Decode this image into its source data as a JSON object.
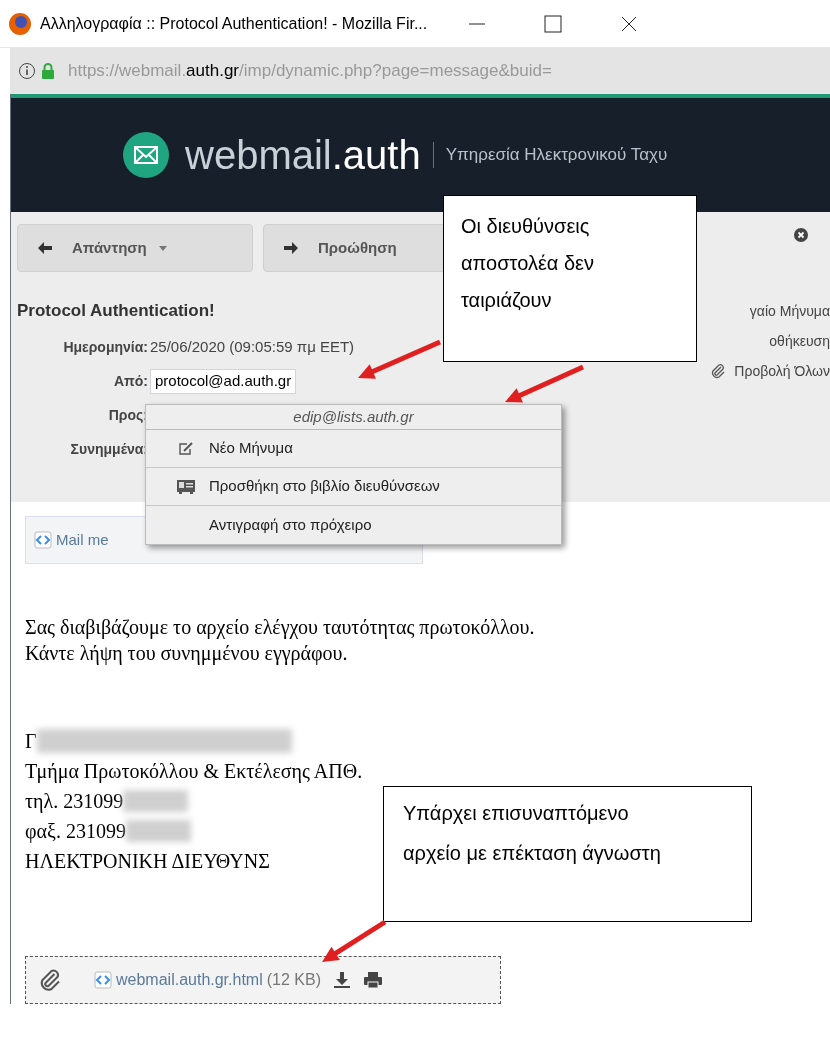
{
  "window": {
    "title": "Αλληλογραφία :: Protocol Authentication! - Mozilla Fir..."
  },
  "address_bar": {
    "url_prefix": "https://webmail.",
    "url_domain": "auth.gr",
    "url_rest": "/imp/dynamic.php?page=message&buid="
  },
  "header": {
    "logo_name": "webmail",
    "logo_suffix": ".auth",
    "tagline": "Υπηρεσία Ηλεκτρονικού Ταχυ"
  },
  "toolbar": {
    "buttons": [
      {
        "label": "Απάντηση",
        "dropdown": true
      },
      {
        "label": "Προώθηση",
        "dropdown": false
      }
    ]
  },
  "message": {
    "subject": "Protocol Authentication!",
    "fields": [
      {
        "label": "Ημερομηνία:",
        "value": "25/06/2020 (09:05:59 πμ EET)"
      },
      {
        "label": "Από:",
        "value": "protocol@ad.auth.gr"
      },
      {
        "label": "Προς:"
      },
      {
        "label": "Συνημμένα:"
      }
    ],
    "actions": [
      {
        "label": "γαίο Μήνυμα"
      },
      {
        "label": "οθήκευση"
      },
      {
        "label": "Προβολή Όλων"
      }
    ]
  },
  "context_menu": {
    "header": "edip@lists.auth.gr",
    "items": [
      {
        "label": "Νέο Μήνυμα"
      },
      {
        "label": "Προσθήκη στο βιβλίο διευθύνσεων"
      },
      {
        "label": "Αντιγραφή στο πρόχειρο"
      }
    ]
  },
  "body_part": {
    "label": "Mail me"
  },
  "body": {
    "paragraphs": [
      "Σας διαβιβάζουμε το αρχείο ελέγχου ταυτότητας πρωτοκόλλου.",
      "Κάντε λήψη του συνημμένου εγγράφου."
    ],
    "signature": [
      {
        "text": "Γ",
        "redacted": true
      },
      {
        "text": "Τμήμα Πρωτοκόλλου & Εκτέλεσης ΑΠΘ.",
        "redacted": false
      },
      {
        "text": "τηλ. 231099",
        "redacted": true
      },
      {
        "text": "φαξ. 231099",
        "redacted": true
      },
      {
        "text": "ΗΛΕΚΤΡΟΝΙΚΗ ΔΙΕΥΘΥΝΣ",
        "redacted": false
      }
    ]
  },
  "attachment": {
    "name": "webmail.auth.gr.html",
    "size": "(12 KB)"
  },
  "callouts": [
    {
      "text": "Οι διευθύνσεις αποστολέα δεν ταιριάζουν"
    },
    {
      "text": "Υπάρχει επισυναπτόμενο αρχείο με επέκταση άγνωστη"
    }
  ]
}
